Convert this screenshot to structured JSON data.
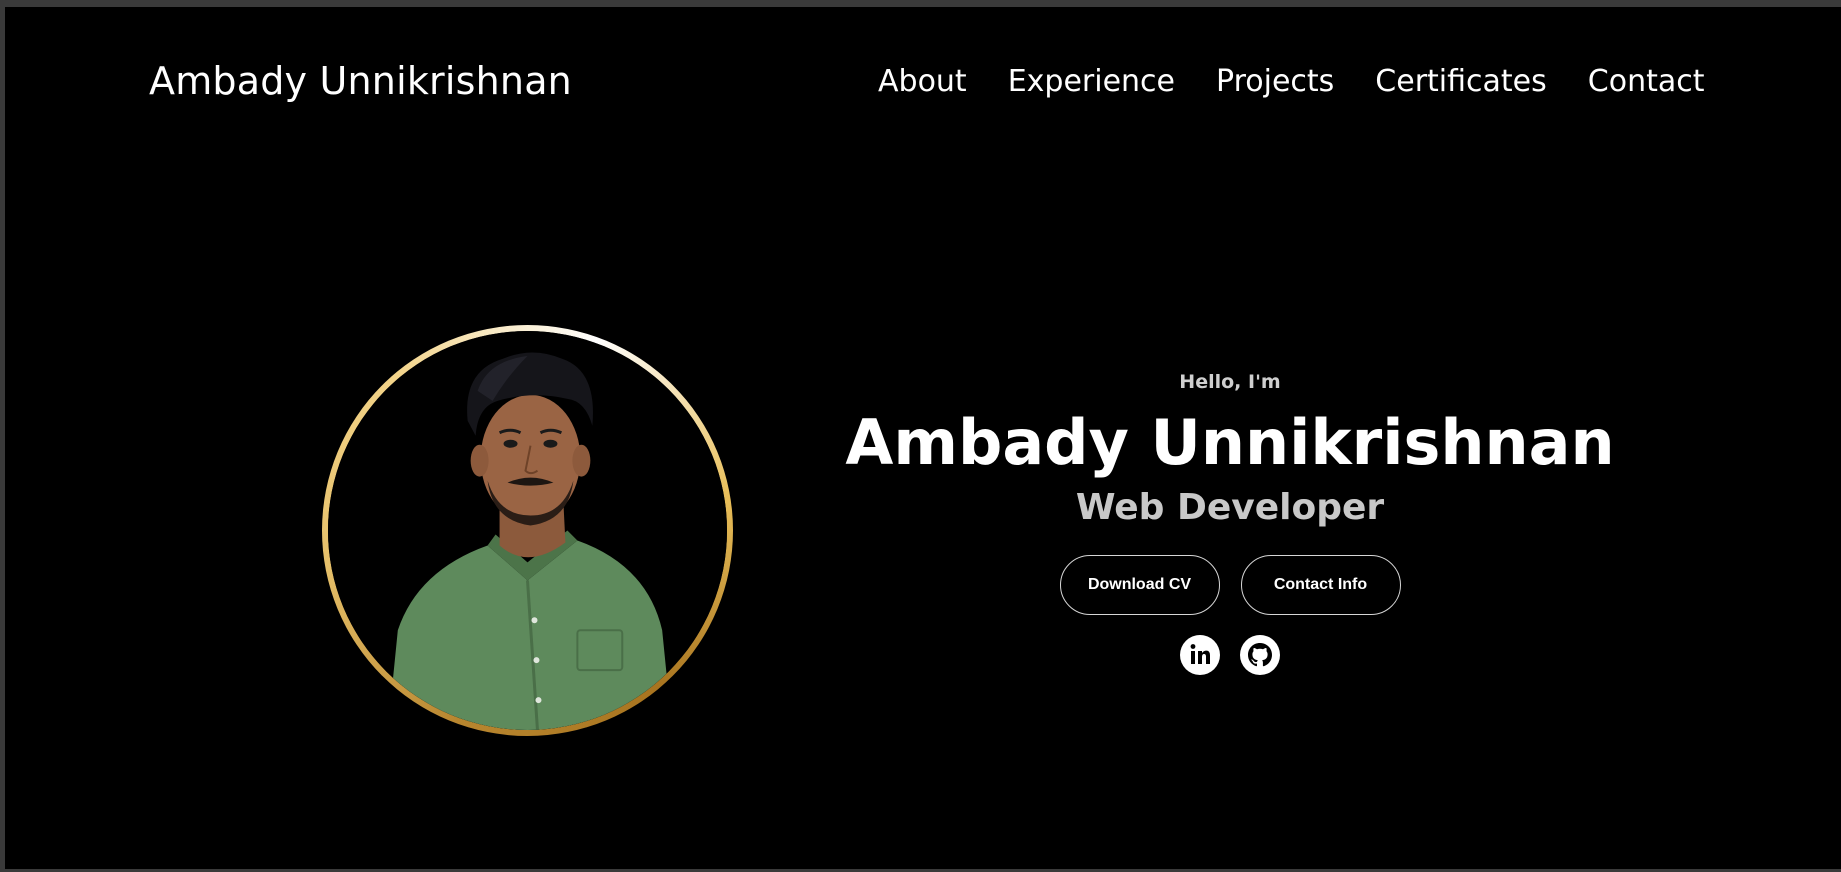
{
  "header": {
    "brand": "Ambady Unnikrishnan",
    "nav": [
      "About",
      "Experience",
      "Projects",
      "Certificates",
      "Contact"
    ]
  },
  "hero": {
    "greeting": "Hello, I'm",
    "name": "Ambady Unnikrishnan",
    "role": "Web Developer",
    "buttons": {
      "download_cv": "Download CV",
      "contact_info": "Contact Info"
    },
    "socials": [
      "linkedin-icon",
      "github-icon"
    ],
    "profile_photo": "profile-photo"
  },
  "colors": {
    "background": "#000000",
    "text": "#ffffff",
    "subtext": "#c8c8c8",
    "ring_gold": "#e6c06a",
    "shirt_green": "#5e8a5c"
  }
}
